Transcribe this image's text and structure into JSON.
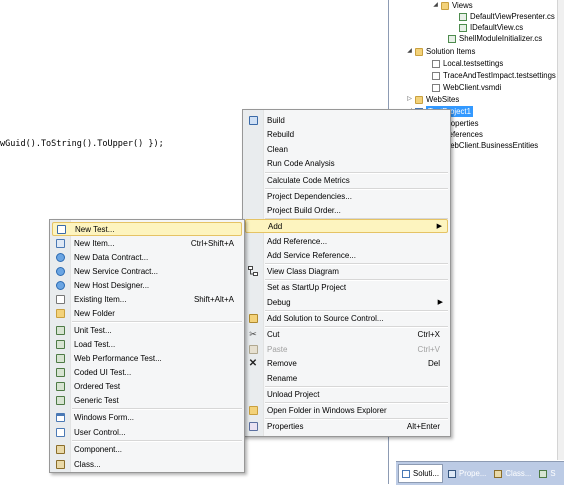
{
  "editor": {
    "code_text": "wGuid().ToString().ToUpper() });"
  },
  "solution_explorer": {
    "items": [
      {
        "label": "Views",
        "icon": "folder-icon",
        "expander": "◢"
      },
      {
        "label": "DefaultViewPresenter.cs",
        "icon": "csharp-file-icon",
        "expander": ""
      },
      {
        "label": "IDefaultView.cs",
        "icon": "csharp-file-icon",
        "expander": ""
      },
      {
        "label": "ShellModuleInitializer.cs",
        "icon": "csharp-file-icon",
        "expander": ""
      },
      {
        "label": "Solution Items",
        "icon": "folder-icon",
        "expander": "◢"
      },
      {
        "label": "Local.testsettings",
        "icon": "settings-file-icon",
        "expander": ""
      },
      {
        "label": "TraceAndTestImpact.testsettings",
        "icon": "settings-file-icon",
        "expander": ""
      },
      {
        "label": "WebClient.vsmdi",
        "icon": "test-list-icon",
        "expander": ""
      },
      {
        "label": "WebSites",
        "icon": "folder-icon",
        "expander": "▷"
      },
      {
        "label": "TestProject1",
        "icon": "project-icon",
        "expander": "◢"
      },
      {
        "label": "Properties",
        "icon": "properties-icon",
        "expander": ""
      },
      {
        "label": "References",
        "icon": "references-icon",
        "expander": ""
      },
      {
        "label": "WebClient.BusinessEntities",
        "icon": "project-icon",
        "expander": ""
      }
    ],
    "tabs": [
      {
        "label": "Soluti...",
        "icon": "solution-explorer-icon"
      },
      {
        "label": "Prope...",
        "icon": "properties-window-icon"
      },
      {
        "label": "Class...",
        "icon": "class-view-icon"
      },
      {
        "label": "S",
        "icon": "server-explorer-icon"
      }
    ]
  },
  "context_menu": {
    "items": [
      {
        "label": "Build",
        "shortcut": "",
        "icon": "build-icon"
      },
      {
        "label": "Rebuild",
        "shortcut": "",
        "icon": ""
      },
      {
        "label": "Clean",
        "shortcut": "",
        "icon": ""
      },
      {
        "label": "Run Code Analysis",
        "shortcut": "",
        "icon": ""
      },
      {
        "label": "Calculate Code Metrics",
        "shortcut": "",
        "icon": ""
      },
      {
        "label": "Project Dependencies...",
        "shortcut": "",
        "icon": ""
      },
      {
        "label": "Project Build Order...",
        "shortcut": "",
        "icon": ""
      },
      {
        "label": "Add",
        "shortcut": "",
        "icon": "",
        "submenu": true
      },
      {
        "label": "Add Reference...",
        "shortcut": "",
        "icon": ""
      },
      {
        "label": "Add Service Reference...",
        "shortcut": "",
        "icon": ""
      },
      {
        "label": "View Class Diagram",
        "shortcut": "",
        "icon": "class-diagram-icon"
      },
      {
        "label": "Set as StartUp Project",
        "shortcut": "",
        "icon": ""
      },
      {
        "label": "Debug",
        "shortcut": "",
        "icon": "",
        "submenu": true
      },
      {
        "label": "Add Solution to Source Control...",
        "shortcut": "",
        "icon": "source-control-icon"
      },
      {
        "label": "Cut",
        "shortcut": "Ctrl+X",
        "icon": "cut-icon"
      },
      {
        "label": "Paste",
        "shortcut": "Ctrl+V",
        "icon": "paste-icon",
        "disabled": true
      },
      {
        "label": "Remove",
        "shortcut": "Del",
        "icon": "remove-icon"
      },
      {
        "label": "Rename",
        "shortcut": "",
        "icon": ""
      },
      {
        "label": "Unload Project",
        "shortcut": "",
        "icon": ""
      },
      {
        "label": "Open Folder in Windows Explorer",
        "shortcut": "",
        "icon": "open-folder-icon"
      },
      {
        "label": "Properties",
        "shortcut": "Alt+Enter",
        "icon": "properties-icon"
      }
    ]
  },
  "add_submenu": {
    "items": [
      {
        "label": "New Test...",
        "shortcut": "",
        "icon": "new-test-icon"
      },
      {
        "label": "New Item...",
        "shortcut": "Ctrl+Shift+A",
        "icon": "new-item-icon"
      },
      {
        "label": "New Data Contract...",
        "shortcut": "",
        "icon": "data-contract-icon"
      },
      {
        "label": "New Service Contract...",
        "shortcut": "",
        "icon": "service-contract-icon"
      },
      {
        "label": "New Host Designer...",
        "shortcut": "",
        "icon": "host-designer-icon"
      },
      {
        "label": "Existing Item...",
        "shortcut": "Shift+Alt+A",
        "icon": "existing-item-icon"
      },
      {
        "label": "New Folder",
        "shortcut": "",
        "icon": "new-folder-icon"
      },
      {
        "label": "Unit Test...",
        "shortcut": "",
        "icon": "unit-test-icon"
      },
      {
        "label": "Load Test...",
        "shortcut": "",
        "icon": "load-test-icon"
      },
      {
        "label": "Web Performance Test...",
        "shortcut": "",
        "icon": "web-test-icon"
      },
      {
        "label": "Coded UI Test...",
        "shortcut": "",
        "icon": "coded-ui-test-icon"
      },
      {
        "label": "Ordered Test",
        "shortcut": "",
        "icon": "ordered-test-icon"
      },
      {
        "label": "Generic Test",
        "shortcut": "",
        "icon": "generic-test-icon"
      },
      {
        "label": "Windows Form...",
        "shortcut": "",
        "icon": "windows-form-icon"
      },
      {
        "label": "User Control...",
        "shortcut": "",
        "icon": "user-control-icon"
      },
      {
        "label": "Component...",
        "shortcut": "",
        "icon": "component-icon"
      },
      {
        "label": "Class...",
        "shortcut": "",
        "icon": "class-icon"
      }
    ]
  }
}
